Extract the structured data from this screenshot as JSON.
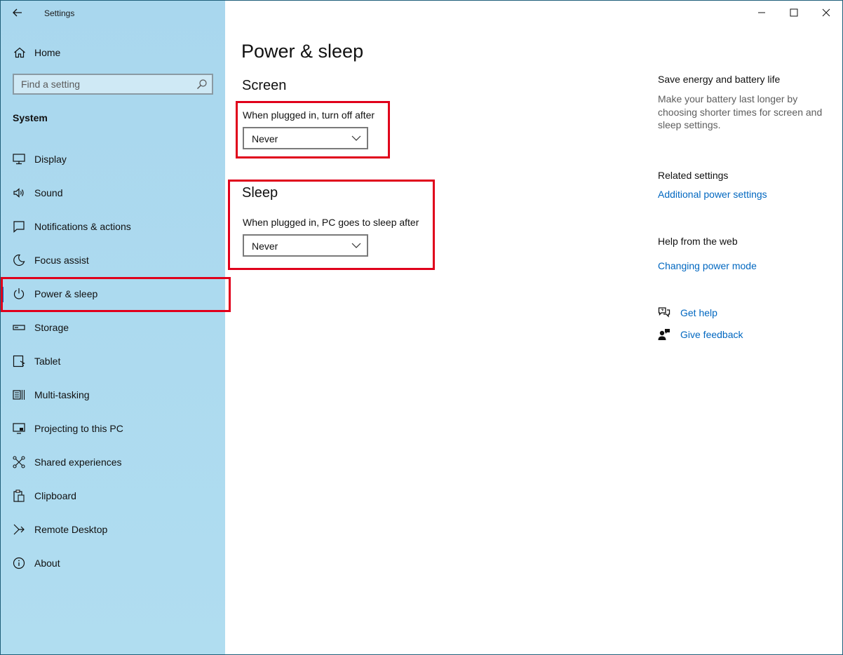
{
  "window": {
    "title": "Settings"
  },
  "sidebar": {
    "home_label": "Home",
    "search_placeholder": "Find a setting",
    "section_label": "System",
    "items": [
      {
        "label": "Display",
        "icon": "monitor-icon"
      },
      {
        "label": "Sound",
        "icon": "speaker-icon"
      },
      {
        "label": "Notifications & actions",
        "icon": "notification-icon"
      },
      {
        "label": "Focus assist",
        "icon": "moon-icon"
      },
      {
        "label": "Power & sleep",
        "icon": "power-icon",
        "selected": true
      },
      {
        "label": "Storage",
        "icon": "storage-icon"
      },
      {
        "label": "Tablet",
        "icon": "tablet-icon"
      },
      {
        "label": "Multi-tasking",
        "icon": "multitasking-icon"
      },
      {
        "label": "Projecting to this PC",
        "icon": "projecting-icon"
      },
      {
        "label": "Shared experiences",
        "icon": "shared-icon"
      },
      {
        "label": "Clipboard",
        "icon": "clipboard-icon"
      },
      {
        "label": "Remote Desktop",
        "icon": "remote-desktop-icon"
      },
      {
        "label": "About",
        "icon": "info-icon"
      }
    ]
  },
  "main": {
    "page_title": "Power & sleep",
    "screen": {
      "heading": "Screen",
      "label": "When plugged in, turn off after",
      "value": "Never"
    },
    "sleep": {
      "heading": "Sleep",
      "label": "When plugged in, PC goes to sleep after",
      "value": "Never"
    }
  },
  "right": {
    "save_energy_heading": "Save energy and battery life",
    "save_energy_text": "Make your battery last longer by choosing shorter times for screen and sleep settings.",
    "related_heading": "Related settings",
    "related_link": "Additional power settings",
    "help_heading": "Help from the web",
    "help_link": "Changing power mode",
    "get_help": "Get help",
    "give_feedback": "Give feedback"
  },
  "colors": {
    "accent": "#0067c0",
    "highlight_box": "#e0001b",
    "sidebar_bg": "#a9d7ee"
  }
}
